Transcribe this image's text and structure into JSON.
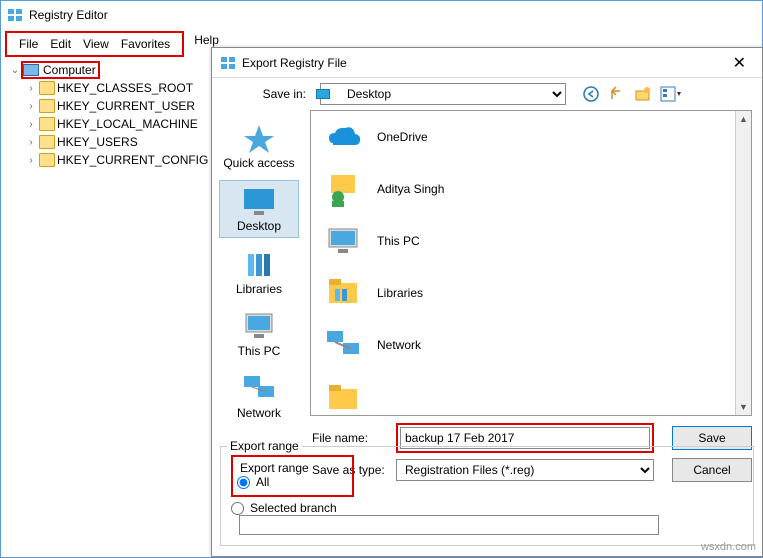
{
  "main": {
    "title": "Registry Editor",
    "menu": [
      "File",
      "Edit",
      "View",
      "Favorites"
    ],
    "menu_help": "Help",
    "tree": {
      "root": "Computer",
      "keys": [
        "HKEY_CLASSES_ROOT",
        "HKEY_CURRENT_USER",
        "HKEY_LOCAL_MACHINE",
        "HKEY_USERS",
        "HKEY_CURRENT_CONFIG"
      ]
    }
  },
  "dialog": {
    "title": "Export Registry File",
    "savein_label": "Save in:",
    "savein_value": "Desktop",
    "sidebar": [
      "Quick access",
      "Desktop",
      "Libraries",
      "This PC",
      "Network"
    ],
    "sidebar_selected": 1,
    "files": [
      "OneDrive",
      "Aditya Singh",
      "This PC",
      "Libraries",
      "Network"
    ],
    "filename_label": "File name:",
    "filename_value": "backup 17 Feb 2017",
    "saveastype_label": "Save as type:",
    "saveastype_value": "Registration Files (*.reg)",
    "save_btn": "Save",
    "cancel_btn": "Cancel",
    "export_range": {
      "group": "Export range",
      "all": "All",
      "branch": "Selected branch",
      "branch_value": ""
    }
  },
  "watermark": "wsxdn.com"
}
